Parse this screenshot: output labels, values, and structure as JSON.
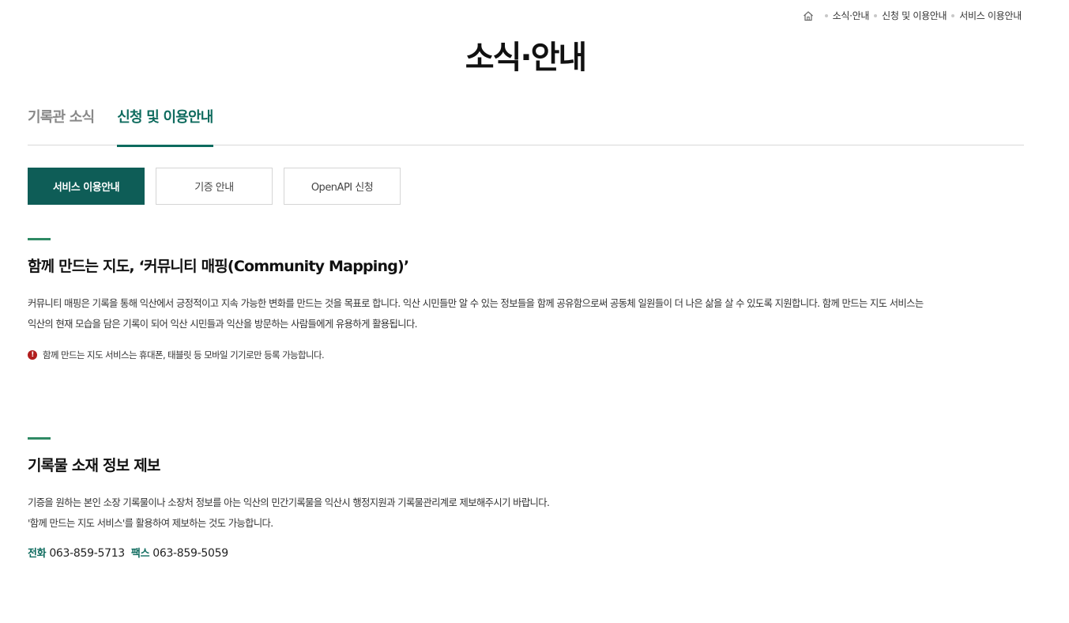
{
  "breadcrumb": {
    "items": [
      "소식·안내",
      "신청 및 이용안내",
      "서비스 이용안내"
    ]
  },
  "page_title": "소식·안내",
  "tabs": [
    {
      "label": "기록관 소식",
      "active": false
    },
    {
      "label": "신청 및 이용안내",
      "active": true
    }
  ],
  "subtabs": [
    {
      "label": "서비스 이용안내",
      "active": true
    },
    {
      "label": "기증 안내",
      "active": false
    },
    {
      "label": "OpenAPI 신청",
      "active": false
    }
  ],
  "section1": {
    "title": "함께 만드는 지도, ‘커뮤니티 매핑(Community Mapping)’",
    "line1": "커뮤니티 매핑은 기록을 통해 익산에서 긍정적이고 지속 가능한 변화를 만드는 것을 목표로 합니다. 익산 시민들만 알 수 있는 정보들을 함께 공유함으로써 공동체 일원들이 더 나은 삶을 살 수 있도록 지원합니다. 함께 만드는 지도 서비스는",
    "line2": "익산의 현재 모습을 담은 기록이 되어 익산 시민들과 익산을 방문하는 사람들에게 유용하게 활용됩니다.",
    "note": "함께 만드는 지도 서비스는 휴대폰, 태블릿 등 모바일 기기로만 등록 가능합니다."
  },
  "section2": {
    "title": "기록물 소재 정보 제보",
    "line1": "기증을 원하는 본인 소장 기록물이나 소장처 정보를 아는 익산의 민간기록물을 익산시 행정지원과 기록물관리계로 제보해주시기 바랍니다.",
    "line2": "'함께 만드는 지도 서비스'를 활용하여 제보하는 것도 가능합니다.",
    "contact": {
      "phone_label": "전화",
      "phone": "063-859-5713",
      "fax_label": "팩스",
      "fax": "063-859-5059"
    }
  },
  "colors": {
    "accent": "#0e6b5e",
    "active_button": "#0e5d57",
    "section_bar": "#2f8a64",
    "warning": "#b21e1e"
  }
}
